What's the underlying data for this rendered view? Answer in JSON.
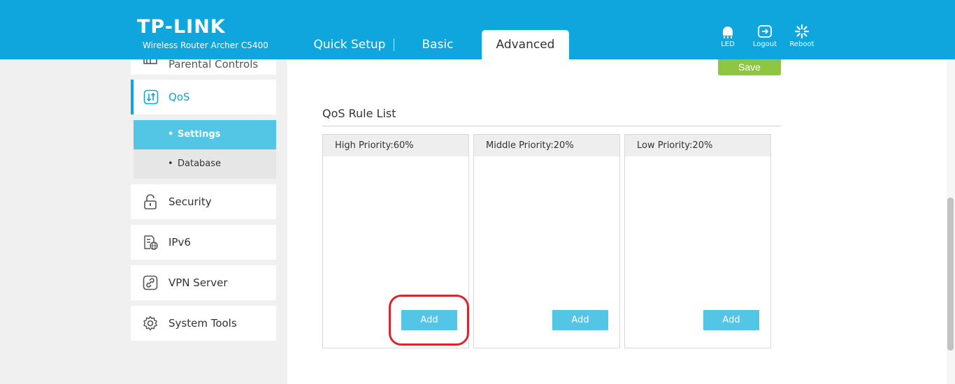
{
  "header": {
    "brand": "TP-LINK",
    "model": "Wireless Router Archer C5400",
    "tabs": [
      {
        "label": "Quick Setup",
        "active": false
      },
      {
        "label": "Basic",
        "active": false
      },
      {
        "label": "Advanced",
        "active": true
      }
    ],
    "actions": [
      {
        "label": "LED",
        "icon": "led-icon"
      },
      {
        "label": "Logout",
        "icon": "logout-icon"
      },
      {
        "label": "Reboot",
        "icon": "reboot-icon"
      }
    ]
  },
  "sidebar": {
    "items": [
      {
        "label": "Parental Controls",
        "icon": "parental-controls-icon",
        "partial": true
      },
      {
        "label": "QoS",
        "icon": "qos-icon",
        "active": true
      },
      {
        "label": "Security",
        "icon": "lock-icon"
      },
      {
        "label": "IPv6",
        "icon": "ipv6-icon"
      },
      {
        "label": "VPN Server",
        "icon": "vpn-icon"
      },
      {
        "label": "System Tools",
        "icon": "gear-icon"
      }
    ],
    "subitems": [
      {
        "label": "Settings",
        "active": true
      },
      {
        "label": "Database",
        "active": false
      }
    ],
    "bullet": "•"
  },
  "main": {
    "save_label": "Save",
    "section_title": "QoS Rule List",
    "priorities": [
      {
        "label": "High Priority:60%",
        "add_label": "Add"
      },
      {
        "label": "Middle Priority:20%",
        "add_label": "Add"
      },
      {
        "label": "Low Priority:20%",
        "add_label": "Add"
      }
    ]
  },
  "colors": {
    "brand_blue": "#0fa6dd",
    "light_blue": "#53c6e6",
    "save_green": "#8ec641",
    "highlight_red": "#d7262e"
  }
}
